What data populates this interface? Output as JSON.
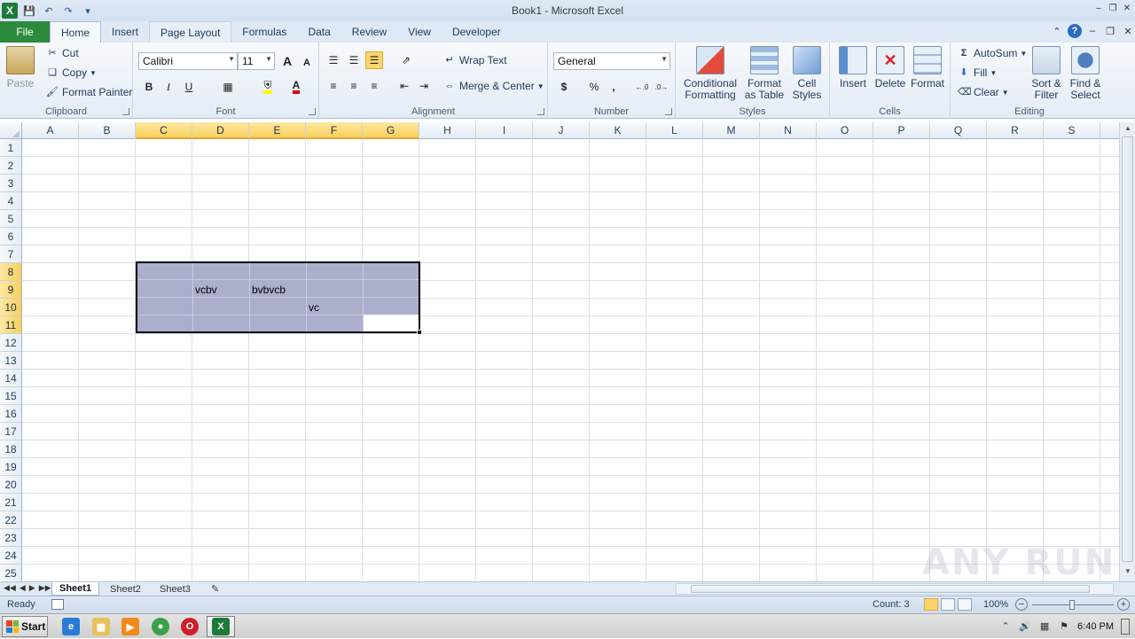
{
  "window": {
    "title": "Book1 - Microsoft Excel"
  },
  "tabs": [
    "File",
    "Home",
    "Insert",
    "Page Layout",
    "Formulas",
    "Data",
    "Review",
    "View",
    "Developer"
  ],
  "ribbon": {
    "clipboard": {
      "paste": "Paste",
      "cut": "Cut",
      "copy": "Copy",
      "format_painter": "Format Painter",
      "label": "Clipboard"
    },
    "font": {
      "name": "Calibri",
      "size": "11",
      "label": "Font",
      "bold": "B",
      "italic": "I",
      "underline": "U",
      "grow": "A",
      "shrink": "A"
    },
    "alignment": {
      "wrap": "Wrap Text",
      "merge": "Merge & Center",
      "label": "Alignment"
    },
    "number": {
      "format": "General",
      "currency": "$",
      "percent": "%",
      "comma": ",",
      "inc_decimal": ".00 +.0",
      "dec_decimal": ".00 ->.0",
      "label": "Number"
    },
    "styles": {
      "conditional_1": "Conditional",
      "conditional_2": "Formatting",
      "table_1": "Format",
      "table_2": "as Table",
      "cell_1": "Cell",
      "cell_2": "Styles",
      "label": "Styles"
    },
    "cells": {
      "insert": "Insert",
      "delete": "Delete",
      "format": "Format",
      "label": "Cells"
    },
    "editing": {
      "autosum": "AutoSum",
      "fill": "Fill",
      "clear": "Clear",
      "sort_1": "Sort &",
      "sort_2": "Filter",
      "find_1": "Find &",
      "find_2": "Select",
      "label": "Editing"
    }
  },
  "columns": [
    "A",
    "B",
    "C",
    "D",
    "E",
    "F",
    "G",
    "H",
    "I",
    "J",
    "K",
    "L",
    "M",
    "N",
    "O",
    "P",
    "Q",
    "R",
    "S"
  ],
  "selected_columns": [
    "C",
    "D",
    "E",
    "F",
    "G"
  ],
  "rows": [
    "1",
    "2",
    "3",
    "4",
    "5",
    "6",
    "7",
    "8",
    "9",
    "10",
    "11",
    "12",
    "13",
    "14",
    "15",
    "16",
    "17",
    "18",
    "19",
    "20",
    "21",
    "22",
    "23",
    "24",
    "25"
  ],
  "selected_rows": [
    "8",
    "9",
    "10",
    "11"
  ],
  "cells": [
    {
      "ref": "D9",
      "value": "vcbv"
    },
    {
      "ref": "E9",
      "value": "bvbvcb"
    },
    {
      "ref": "F10",
      "value": "vc"
    }
  ],
  "sheets": [
    "Sheet1",
    "Sheet2",
    "Sheet3"
  ],
  "active_sheet": "Sheet1",
  "status": {
    "ready": "Ready",
    "count": "Count: 3",
    "zoom": "100%",
    "zoom_minus": "−",
    "zoom_plus": "+"
  },
  "taskbar": {
    "start": "Start",
    "time": "6:40 PM"
  },
  "watermark": "ANY RUN",
  "colors": {
    "selection_fill": "#abaecd",
    "header_selected": "#f8cf5a",
    "file_tab": "#2b8a3e"
  }
}
